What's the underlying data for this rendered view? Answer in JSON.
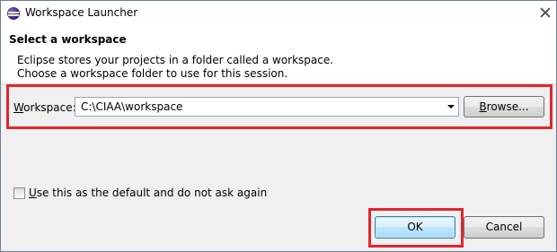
{
  "window": {
    "title": "Workspace Launcher",
    "close_icon": "close-icon",
    "app_icon": "eclipse-icon"
  },
  "header": {
    "heading": "Select a workspace",
    "description_line1": "Eclipse stores your projects in a folder called a workspace.",
    "description_line2": "Choose a workspace folder to use for this session."
  },
  "workspace": {
    "label_mnemonic": "W",
    "label_rest": "orkspace:",
    "value": "C:\\CIAA\\workspace",
    "browse_mnemonic": "B",
    "browse_rest": "rowse..."
  },
  "default_option": {
    "checked": false,
    "label_mnemonic": "U",
    "label_rest": "se this as the default and do not ask again"
  },
  "footer": {
    "ok_label": "OK",
    "cancel_label": "Cancel"
  },
  "colors": {
    "highlight": "#e0262e",
    "ok_button_border": "#3c7fb1"
  }
}
